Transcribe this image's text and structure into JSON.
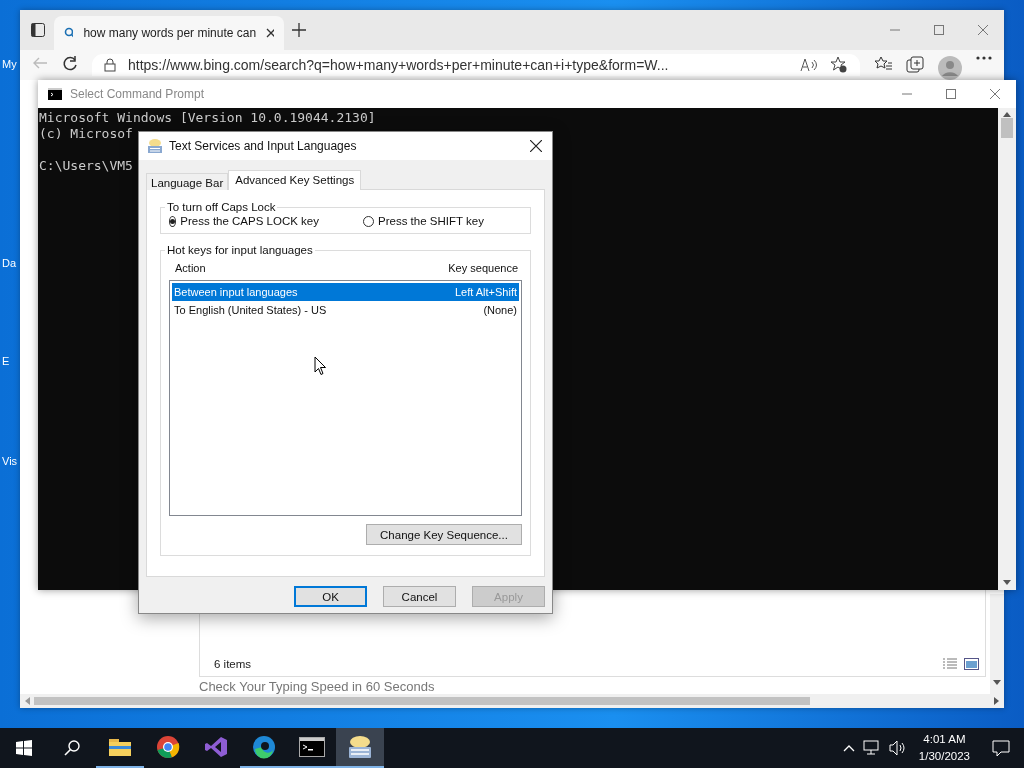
{
  "desktop_icons": [
    {
      "label": "My"
    },
    {
      "label": "Da"
    },
    {
      "label": "E"
    },
    {
      "label": "Vis"
    }
  ],
  "browser": {
    "tab_title": "how many words per minute can",
    "url": "https://www.bing.com/search?q=how+many+words+per+minute+can+i+type&form=W...",
    "status": "6 items",
    "result_title": "Check Your Typing Speed in 60 Seconds"
  },
  "console": {
    "title": "Select Command Prompt",
    "lines": [
      {
        "text": "Microsoft Windows [Version 10.0.19044.2130]",
        "gap_before": false
      },
      {
        "text": "(c) Microsof",
        "gap_before": false
      },
      {
        "text": "C:\\Users\\VM5",
        "gap_before": true
      }
    ]
  },
  "dialog": {
    "title": "Text Services and Input Languages",
    "tabs": [
      {
        "label": "Language Bar",
        "selected": false
      },
      {
        "label": "Advanced Key Settings",
        "selected": true
      }
    ],
    "caps_lock": {
      "legend": "To turn off Caps Lock",
      "options": [
        {
          "label": "Press the CAPS LOCK key",
          "selected": true
        },
        {
          "label": "Press the SHIFT key",
          "selected": false
        }
      ]
    },
    "hotkeys": {
      "legend": "Hot keys for input languages",
      "columns": [
        "Action",
        "Key sequence"
      ],
      "rows": [
        {
          "action": "Between input languages",
          "sequence": "Left Alt+Shift",
          "selected": true
        },
        {
          "action": "To English (United States) - US",
          "sequence": "(None)",
          "selected": false
        }
      ]
    },
    "change_button": "Change Key Sequence...",
    "buttons": [
      {
        "label": "OK",
        "focused": true,
        "disabled": false
      },
      {
        "label": "Cancel",
        "focused": false,
        "disabled": false
      },
      {
        "label": "Apply",
        "focused": false,
        "disabled": true
      }
    ]
  },
  "taskbar": {
    "apps": [
      {
        "kind": "explorer",
        "running": true,
        "selected": false
      },
      {
        "kind": "chrome",
        "running": false,
        "selected": false
      },
      {
        "kind": "studio",
        "running": false,
        "selected": false
      },
      {
        "kind": "edge",
        "running": true,
        "selected": false
      },
      {
        "kind": "console",
        "running": true,
        "selected": false
      },
      {
        "kind": "keyboard",
        "running": true,
        "selected": true
      }
    ],
    "time": "4:01 AM",
    "date": "1/30/2023"
  }
}
